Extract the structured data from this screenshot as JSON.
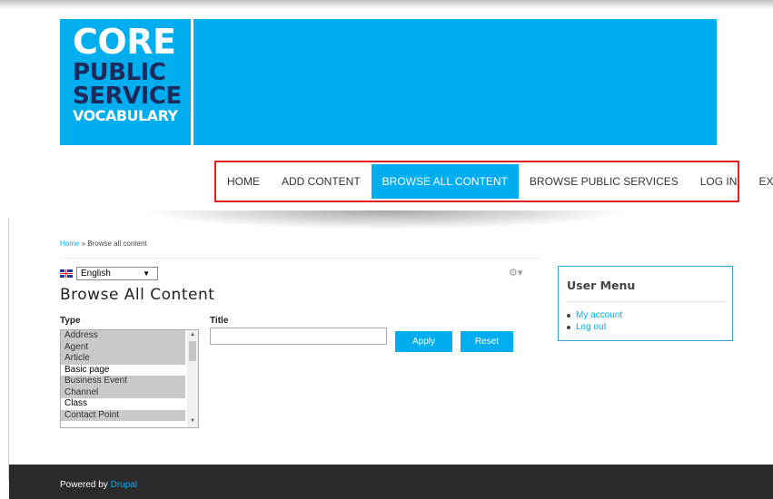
{
  "logo": {
    "line1": "CORE",
    "line2": "PUBLIC",
    "line3": "SERVICE",
    "line4": "VOCABULARY",
    "color_bg": "#00aeef",
    "color_dark": "#1b2a5a"
  },
  "nav": {
    "items": [
      {
        "label": "HOME",
        "active": false
      },
      {
        "label": "ADD CONTENT",
        "active": false
      },
      {
        "label": "BROWSE ALL CONTENT",
        "active": true
      },
      {
        "label": "BROWSE PUBLIC SERVICES",
        "active": false
      },
      {
        "label": "LOG IN",
        "active": false
      },
      {
        "label": "EXPORT",
        "active": false
      }
    ],
    "highlight_color": "#e0201f"
  },
  "breadcrumb": {
    "home": "Home",
    "separator": "»",
    "current": "Browse all content"
  },
  "language": {
    "selected": "English",
    "icon": "uk-flag-icon"
  },
  "page": {
    "title": "Browse All Content",
    "settings_icon": "gear-icon"
  },
  "filters": {
    "type_label": "Type",
    "type_options": [
      {
        "label": "Address",
        "selected": true
      },
      {
        "label": "Agent",
        "selected": true
      },
      {
        "label": "Article",
        "selected": true
      },
      {
        "label": "Basic page",
        "selected": false
      },
      {
        "label": "Business Event",
        "selected": true
      },
      {
        "label": "Channel",
        "selected": true
      },
      {
        "label": "Class",
        "selected": false
      },
      {
        "label": "Contact Point",
        "selected": true
      }
    ],
    "title_label": "Title",
    "title_value": "",
    "apply_label": "Apply",
    "reset_label": "Reset"
  },
  "user_menu": {
    "title": "User Menu",
    "links": [
      "My account",
      "Log out"
    ]
  },
  "footer": {
    "prefix": "Powered by",
    "link": "Drupal"
  },
  "colors": {
    "accent": "#00aeef",
    "footer_bg": "#2a2a2a"
  }
}
